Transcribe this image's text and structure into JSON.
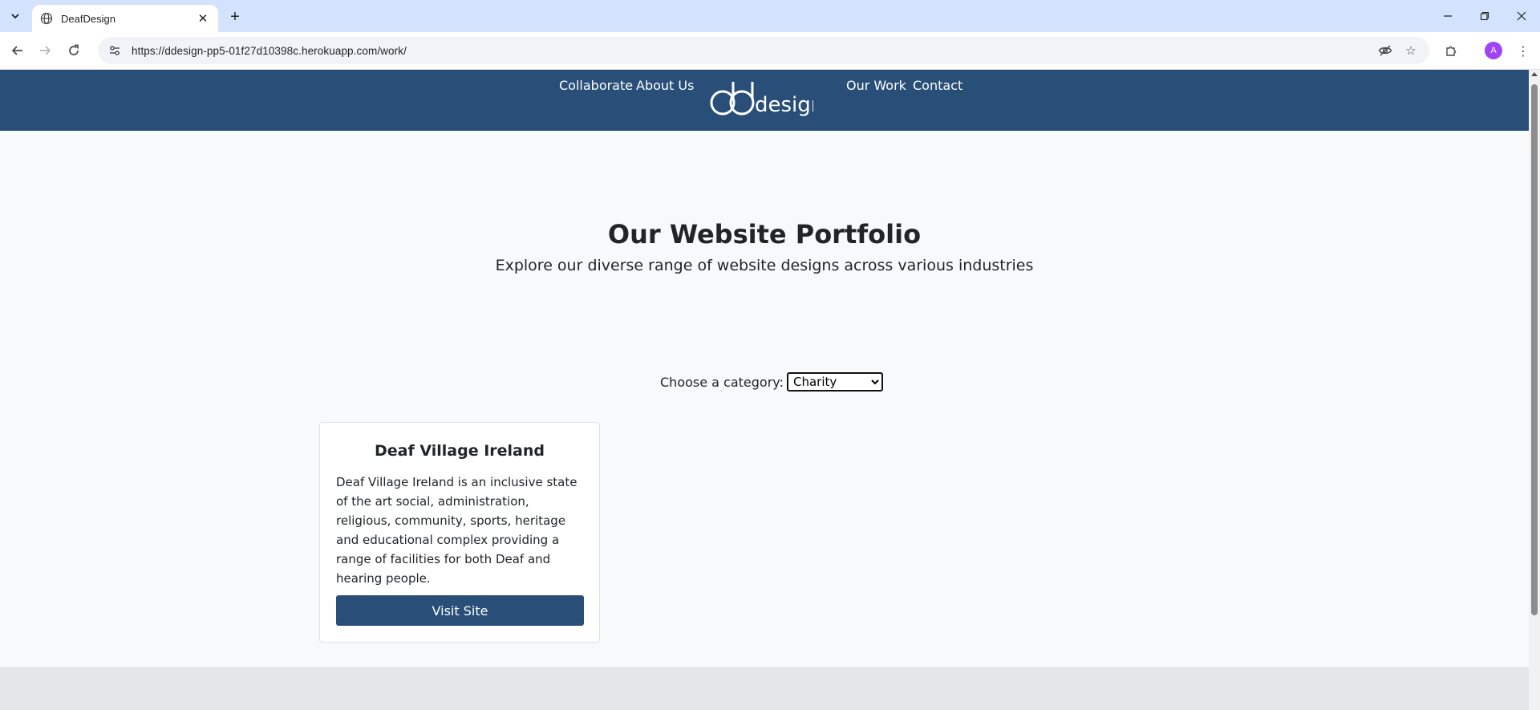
{
  "browser": {
    "tab_title": "DeafDesign",
    "url": "https://ddesign-pp5-01f27d10398c.herokuapp.com/work/",
    "profile_initial": "A"
  },
  "site": {
    "nav": {
      "collaborate": "Collaborate",
      "about": "About Us",
      "our_work": "Our Work",
      "contact": "Contact"
    },
    "logo_text": "design",
    "hero": {
      "title": "Our Website Portfolio",
      "subtitle": "Explore our diverse range of website designs across various industries"
    },
    "filter": {
      "label": "Choose a category:",
      "selected": "Charity"
    },
    "cards": [
      {
        "title": "Deaf Village Ireland",
        "description": "Deaf Village Ireland is an inclusive state of the art social, administration, religious, community, sports, heritage and educational complex providing a range of facilities for both Deaf and hearing people.",
        "button": "Visit Site"
      }
    ]
  },
  "colors": {
    "nav_bg": "#294f79",
    "page_bg": "#f8f9fa",
    "tabstrip_bg": "#d3e3fd"
  }
}
